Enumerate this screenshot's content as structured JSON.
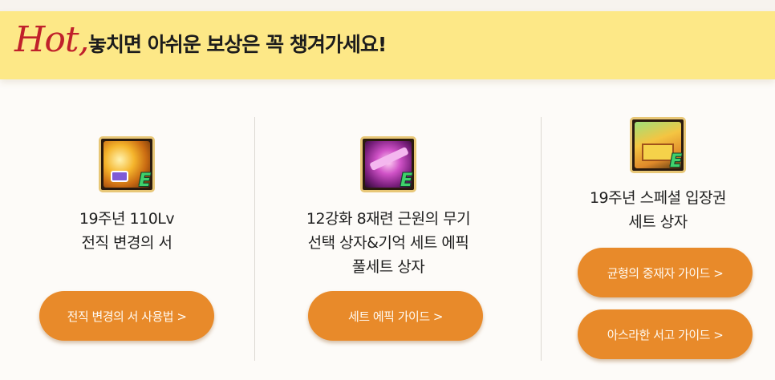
{
  "banner": {
    "hot_label": "Hot,",
    "text": "놓치면 아쉬운 보상은 꼭 챙겨가세요!"
  },
  "items": [
    {
      "icon": "job-change-scroll-icon",
      "title_lines": [
        "19주년 110Lv",
        "전직 변경의 서"
      ],
      "buttons": [
        "전직 변경의 서 사용법 >"
      ]
    },
    {
      "icon": "weapon-box-icon",
      "title_lines": [
        "12강화 8재련 근원의 무기",
        "선택 상자&기억 세트 에픽",
        "풀세트 상자"
      ],
      "buttons": [
        "세트 에픽 가이드 >"
      ]
    },
    {
      "icon": "ticket-box-icon",
      "title_lines": [
        "19주년 스페셜 입장권",
        "세트 상자"
      ],
      "buttons": [
        "균형의 중재자 가이드 >",
        "아스라한 서고 가이드 >"
      ]
    }
  ],
  "colors": {
    "banner_bg": "#fde887",
    "hot_red": "#c0212b",
    "button_orange": "#e88a2a",
    "badge_green": "#3fd16b"
  }
}
